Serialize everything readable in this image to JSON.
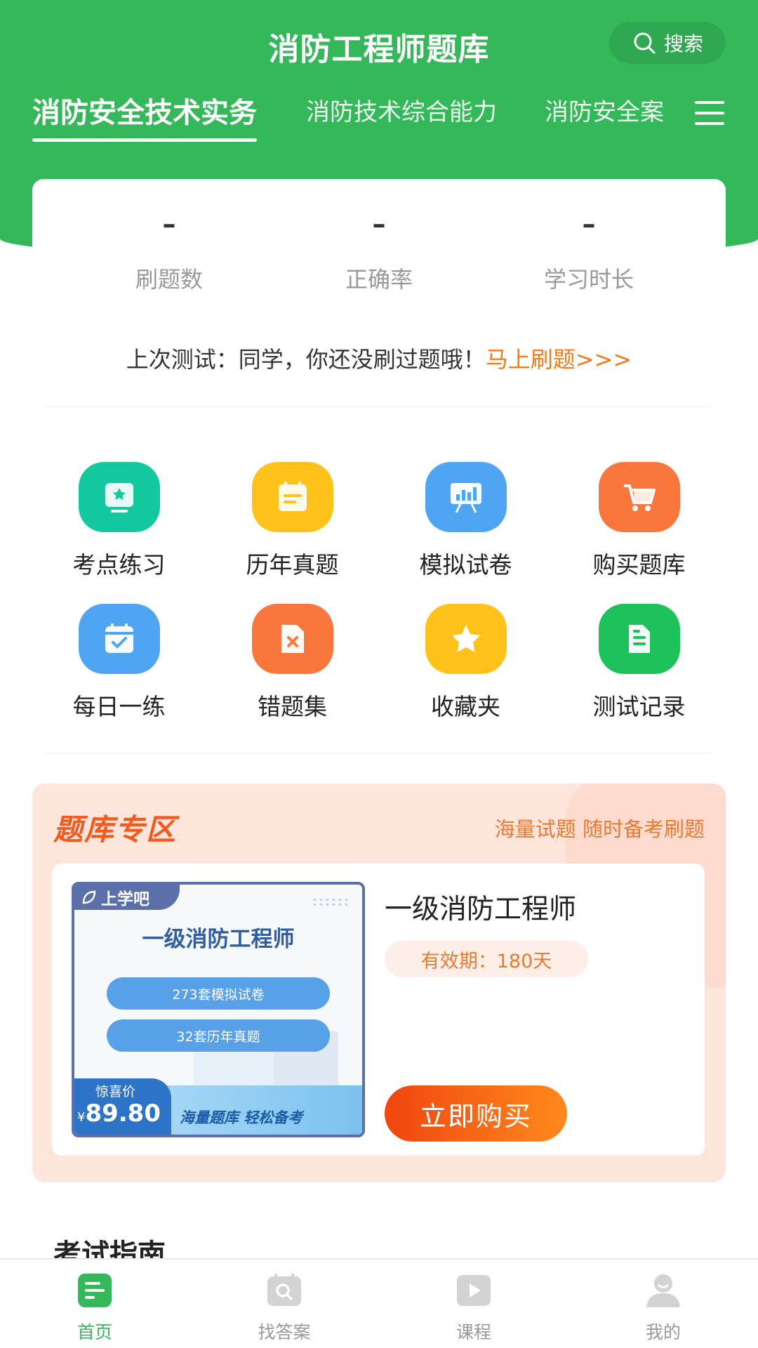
{
  "header": {
    "title": "消防工程师题库",
    "search_label": "搜索"
  },
  "tabs": [
    {
      "label": "消防安全技术实务",
      "active": true
    },
    {
      "label": "消防技术综合能力",
      "active": false
    },
    {
      "label": "消防安全案",
      "active": false
    }
  ],
  "stats": [
    {
      "value": "–",
      "label": "刷题数"
    },
    {
      "value": "–",
      "label": "正确率"
    },
    {
      "value": "–",
      "label": "学习时长"
    }
  ],
  "last_test": {
    "prefix": "上次测试：同学，你还没刷过题哦！",
    "link": "马上刷题>>>"
  },
  "grid": [
    {
      "label": "考点练习",
      "icon": "star-board-icon",
      "color": "#13c89f"
    },
    {
      "label": "历年真题",
      "icon": "calendar-notes-icon",
      "color": "#ffc21a"
    },
    {
      "label": "模拟试卷",
      "icon": "presentation-chart-icon",
      "color": "#4ea5f2"
    },
    {
      "label": "购买题库",
      "icon": "shopping-cart-icon",
      "color": "#f9763c"
    },
    {
      "label": "每日一练",
      "icon": "calendar-check-icon",
      "color": "#4ea5f2"
    },
    {
      "label": "错题集",
      "icon": "error-document-icon",
      "color": "#f9763c"
    },
    {
      "label": "收藏夹",
      "icon": "star-icon",
      "color": "#ffc21a"
    },
    {
      "label": "测试记录",
      "icon": "document-lines-icon",
      "color": "#1ec25a"
    }
  ],
  "promo": {
    "title": "题库专区",
    "slogan": "海量试题 随时备考刷题",
    "product": {
      "cover_brand": "上学吧",
      "cover_title": "一级消防工程师",
      "cover_pill_1": "273套模拟试卷",
      "cover_pill_2": "32套历年真题",
      "price_label": "惊喜价",
      "currency": "¥",
      "price": "89.80",
      "cover_slogan": "海量题库 轻松备考",
      "name": "一级消防工程师",
      "validity": "有效期：180天",
      "buy_label": "立即购买"
    }
  },
  "guide": {
    "title": "考试指南"
  },
  "bottom_nav": [
    {
      "label": "首页",
      "icon": "home-document-icon",
      "active": true
    },
    {
      "label": "找答案",
      "icon": "search-answer-icon",
      "active": false
    },
    {
      "label": "课程",
      "icon": "video-play-icon",
      "active": false
    },
    {
      "label": "我的",
      "icon": "user-profile-icon",
      "active": false
    }
  ],
  "colors": {
    "brand_green": "#35b85a",
    "accent_orange": "#f07a1c",
    "promo_bg": "#fde5dc"
  }
}
